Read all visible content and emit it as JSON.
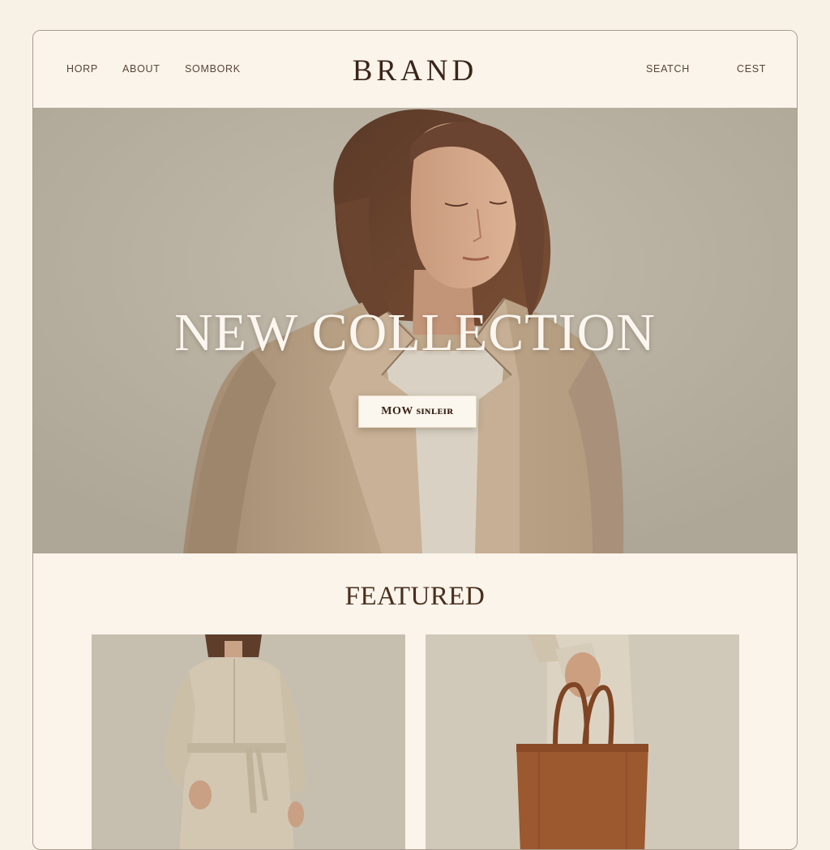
{
  "header": {
    "nav_left": [
      "HORP",
      "ABOUT",
      "SOMBORK"
    ],
    "logo": "BRAND",
    "nav_right": [
      "SEATCH",
      "CEST"
    ]
  },
  "hero": {
    "title": "NEW COLLECTION",
    "cta_label": "MOW ѕɪɴʟᴇɪʀ"
  },
  "featured": {
    "title": "FEATURED",
    "products": [
      {
        "image": "model-in-belted-beige-dress"
      },
      {
        "image": "hand-holding-brown-leather-tote"
      }
    ]
  },
  "colors": {
    "background": "#f7f1e6",
    "text_dark": "#3a2518",
    "hero_backdrop": "#b6ae9f",
    "coat": "#b89f83",
    "tote": "#9a5630"
  }
}
